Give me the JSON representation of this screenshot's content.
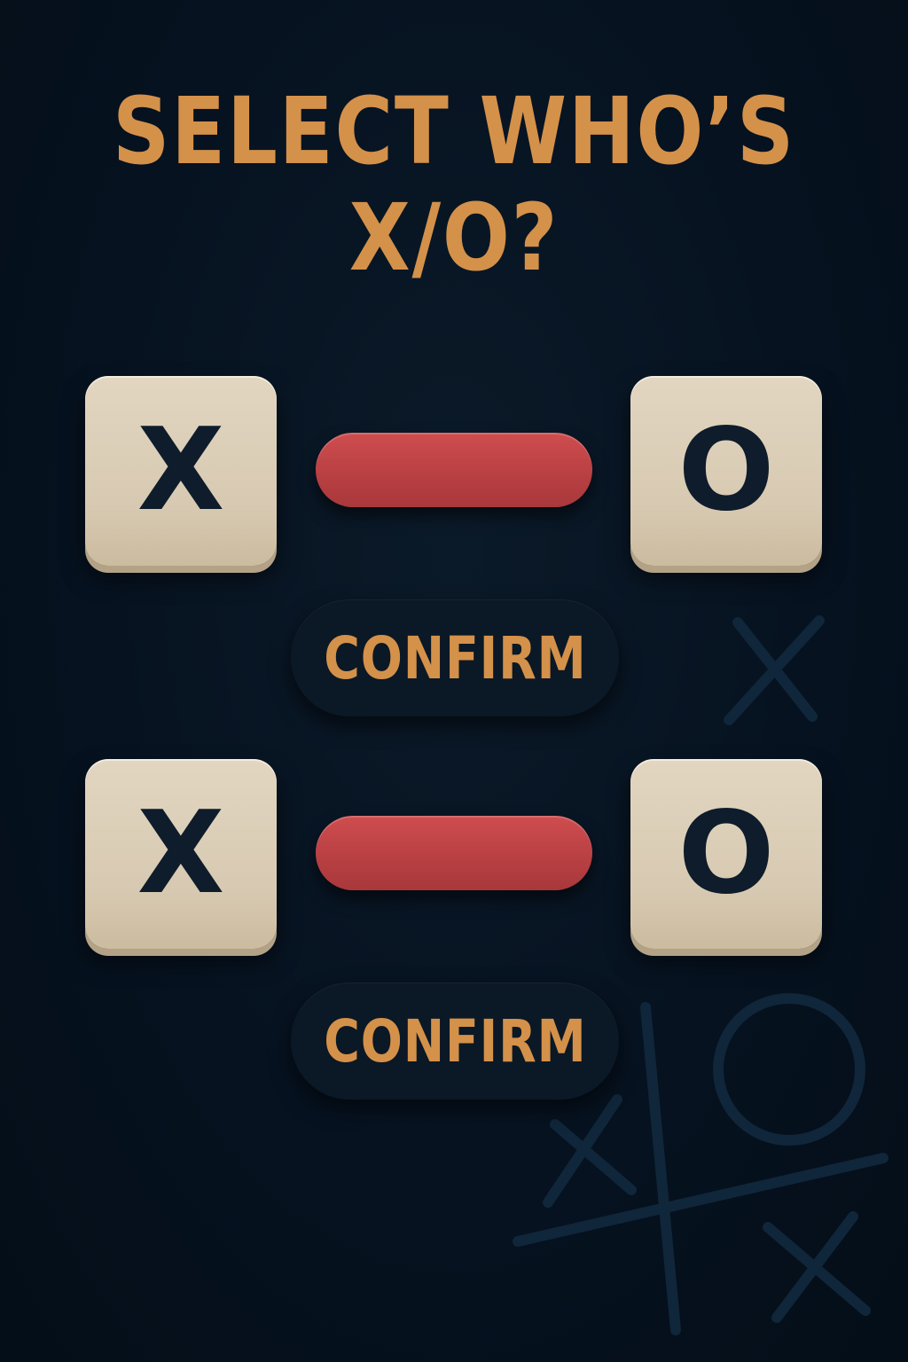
{
  "title": {
    "line1": "SELECT WHO’S",
    "line2": "X/O?"
  },
  "colors": {
    "background": "#061220",
    "accent": "#d4914a",
    "tile": "#dccfb8",
    "tile_text": "#0e1c2b",
    "bar": "#c04447",
    "button_bg": "#0b1826",
    "decor_lines": "#10263a"
  },
  "rows": [
    {
      "left_tile": {
        "letter": "X"
      },
      "right_tile": {
        "letter": "O"
      },
      "confirm_label": "CONFIRM"
    },
    {
      "left_tile": {
        "letter": "X"
      },
      "right_tile": {
        "letter": "O"
      },
      "confirm_label": "CONFIRM"
    }
  ],
  "decor_icons": [
    "x-mark-icon",
    "tic-tac-toe-grid-icon",
    "o-mark-icon"
  ]
}
